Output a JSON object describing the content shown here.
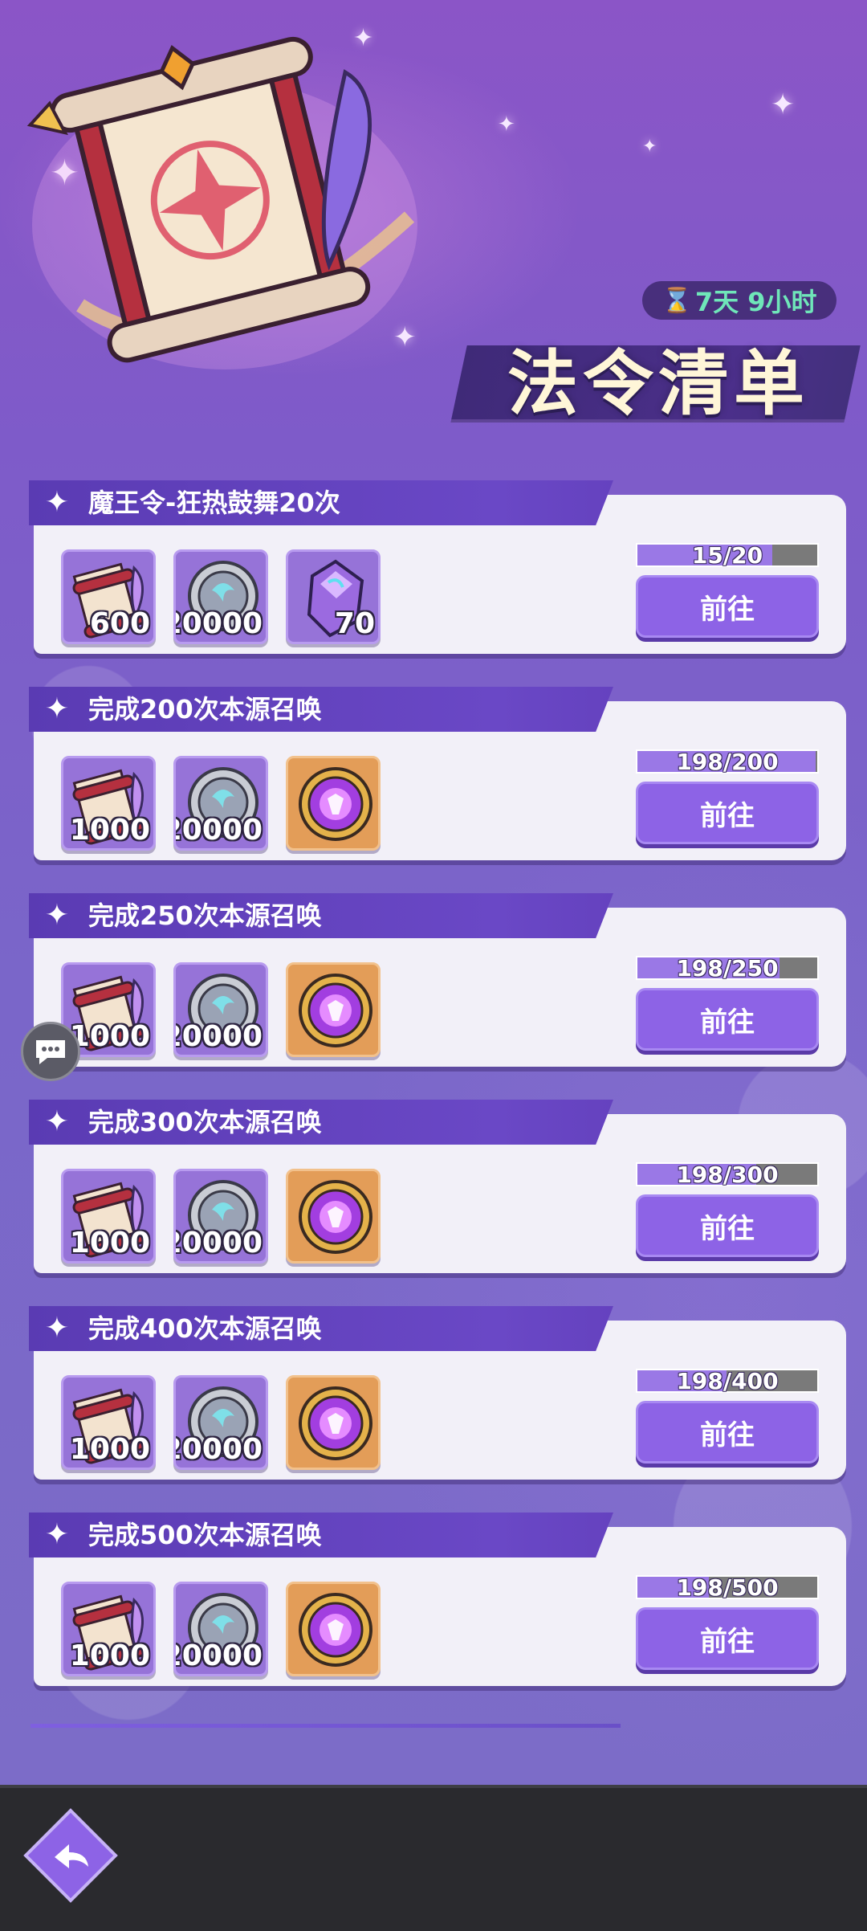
{
  "timer": {
    "icon": "hourglass-icon",
    "text": "7天 9小时"
  },
  "title": "法令清单",
  "tasks": [
    {
      "title": "魔王令-狂热鼓舞20次",
      "rewards": [
        {
          "icon": "scroll-quill-icon",
          "amount": "600"
        },
        {
          "icon": "silver-coin-icon",
          "amount": "20000"
        },
        {
          "icon": "purple-crystal-icon",
          "amount": "70"
        }
      ],
      "progress_text": "15/20",
      "progress": 0.75,
      "button": "前往"
    },
    {
      "title": "完成200次本源召唤",
      "rewards": [
        {
          "icon": "scroll-quill-icon",
          "amount": "1000"
        },
        {
          "icon": "silver-coin-icon",
          "amount": "20000"
        },
        {
          "icon": "purple-orb-icon",
          "amount": ""
        }
      ],
      "progress_text": "198/200",
      "progress": 0.99,
      "button": "前往"
    },
    {
      "title": "完成250次本源召唤",
      "rewards": [
        {
          "icon": "scroll-quill-icon",
          "amount": "1000"
        },
        {
          "icon": "silver-coin-icon",
          "amount": "20000"
        },
        {
          "icon": "purple-orb-icon",
          "amount": ""
        }
      ],
      "progress_text": "198/250",
      "progress": 0.792,
      "button": "前往"
    },
    {
      "title": "完成300次本源召唤",
      "rewards": [
        {
          "icon": "scroll-quill-icon",
          "amount": "1000"
        },
        {
          "icon": "silver-coin-icon",
          "amount": "20000"
        },
        {
          "icon": "purple-orb-icon",
          "amount": ""
        }
      ],
      "progress_text": "198/300",
      "progress": 0.66,
      "button": "前往"
    },
    {
      "title": "完成400次本源召唤",
      "rewards": [
        {
          "icon": "scroll-quill-icon",
          "amount": "1000"
        },
        {
          "icon": "silver-coin-icon",
          "amount": "20000"
        },
        {
          "icon": "purple-orb-icon",
          "amount": ""
        }
      ],
      "progress_text": "198/400",
      "progress": 0.495,
      "button": "前往"
    },
    {
      "title": "完成500次本源召唤",
      "rewards": [
        {
          "icon": "scroll-quill-icon",
          "amount": "1000"
        },
        {
          "icon": "silver-coin-icon",
          "amount": "20000"
        },
        {
          "icon": "purple-orb-icon",
          "amount": ""
        }
      ],
      "progress_text": "198/500",
      "progress": 0.396,
      "button": "前往"
    }
  ],
  "colors": {
    "accent": "#8d63e6",
    "header": "#5a3bb3",
    "timer": "#6fe6b9",
    "title": "#fff6d8"
  },
  "icons": {
    "chat": "chat-bubble-icon",
    "back": "back-arrow-icon"
  }
}
